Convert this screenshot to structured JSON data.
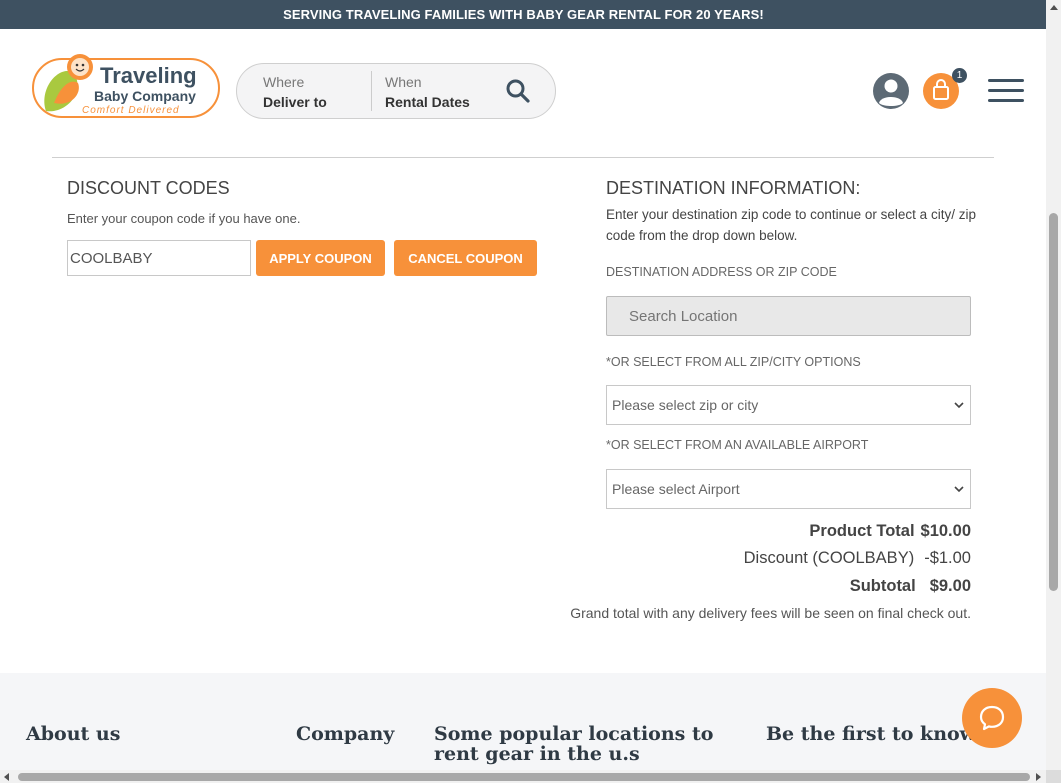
{
  "topbar": {
    "text": "SERVING TRAVELING FAMILIES WITH BABY GEAR RENTAL FOR 20 YEARS!"
  },
  "header": {
    "logo": {
      "line1": "Traveling",
      "line2": "Baby Company",
      "tagline": "Comfort Delivered"
    },
    "search": {
      "where_label": "Where",
      "where_value": "Deliver to",
      "when_label": "When",
      "when_value": "Rental Dates",
      "icon": "search-icon"
    },
    "icons": [
      "user-icon",
      "cart-icon",
      "menu-icon"
    ],
    "cart_count": "1"
  },
  "discount": {
    "title": "DISCOUNT CODES",
    "help": "Enter your coupon code if you have one.",
    "coupon_value": "COOLBABY",
    "apply_label": "APPLY COUPON",
    "cancel_label": "CANCEL COUPON"
  },
  "destination": {
    "title": "DESTINATION INFORMATION:",
    "help": "Enter your destination zip code to continue or select a city/ zip code from the drop down below.",
    "address_label": "DESTINATION ADDRESS OR ZIP CODE",
    "address_placeholder": "Search Location",
    "zip_label": "*OR SELECT FROM ALL ZIP/CITY OPTIONS",
    "zip_selected": "Please select zip or city",
    "airport_label": "*OR SELECT FROM AN AVAILABLE AIRPORT",
    "airport_selected": "Please select Airport"
  },
  "totals": {
    "product_label": "Product Total",
    "product_value": "$10.00",
    "discount_label": "Discount (COOLBABY)",
    "discount_value": "-$1.00",
    "subtotal_label": "Subtotal",
    "subtotal_value": "$9.00",
    "note": "Grand total with any delivery fees will be seen on final check out."
  },
  "footer": {
    "about": "About us",
    "company": "Company",
    "popular": "Some popular locations to rent gear in the u.s",
    "first": "Be the first to know"
  },
  "colors": {
    "accent": "#f7913a",
    "navy": "#3e5161"
  }
}
